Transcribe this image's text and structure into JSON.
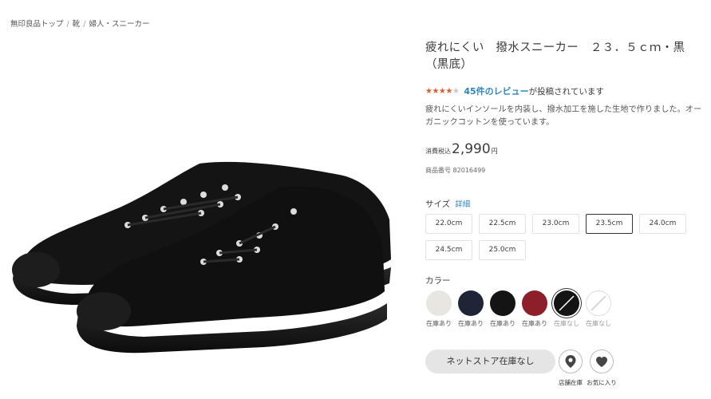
{
  "breadcrumb": {
    "items": [
      "無印良品トップ",
      "靴",
      "婦人・スニーカー"
    ],
    "separator": "/"
  },
  "product": {
    "title": "疲れにくい　撥水スニーカー　２３．５ｃｍ・黒（黒底）",
    "rating": 4,
    "rating_max": 5,
    "review_link": "45件のレビュー",
    "review_suffix": "が投稿されています",
    "description": "疲れにくいインソールを内装し、撥水加工を施した生地で作りました。オーガニックコットンを使っています。",
    "tax_label": "消費税込",
    "price": "2,990",
    "currency": "円",
    "code_label": "商品番号",
    "code": "82016499"
  },
  "size": {
    "label": "サイズ",
    "detail_link": "詳細",
    "options": [
      "22.0cm",
      "22.5cm",
      "23.0cm",
      "23.5cm",
      "24.0cm",
      "24.5cm",
      "25.0cm"
    ],
    "selected": "23.5cm"
  },
  "color": {
    "label": "カラー",
    "options": [
      {
        "hex": "#e8e6e1",
        "stock": "在庫あり",
        "available": true
      },
      {
        "hex": "#1f2537",
        "stock": "在庫あり",
        "available": true
      },
      {
        "hex": "#141414",
        "stock": "在庫あり",
        "available": true
      },
      {
        "hex": "#8c1f2a",
        "stock": "在庫あり",
        "available": true
      },
      {
        "hex": "#141414",
        "stock": "在庫なし",
        "available": false,
        "selected": true
      },
      {
        "hex": "#ffffff",
        "stock": "在庫なし",
        "available": false
      }
    ]
  },
  "actions": {
    "cart_button": "ネットストア在庫なし",
    "store_stock": "店舗在庫",
    "favorite": "お気に入り",
    "store_icon": "location-pin-icon",
    "favorite_icon": "heart-icon"
  },
  "colors": {
    "accent_link": "#2e86c1",
    "star": "#e35a2a"
  }
}
